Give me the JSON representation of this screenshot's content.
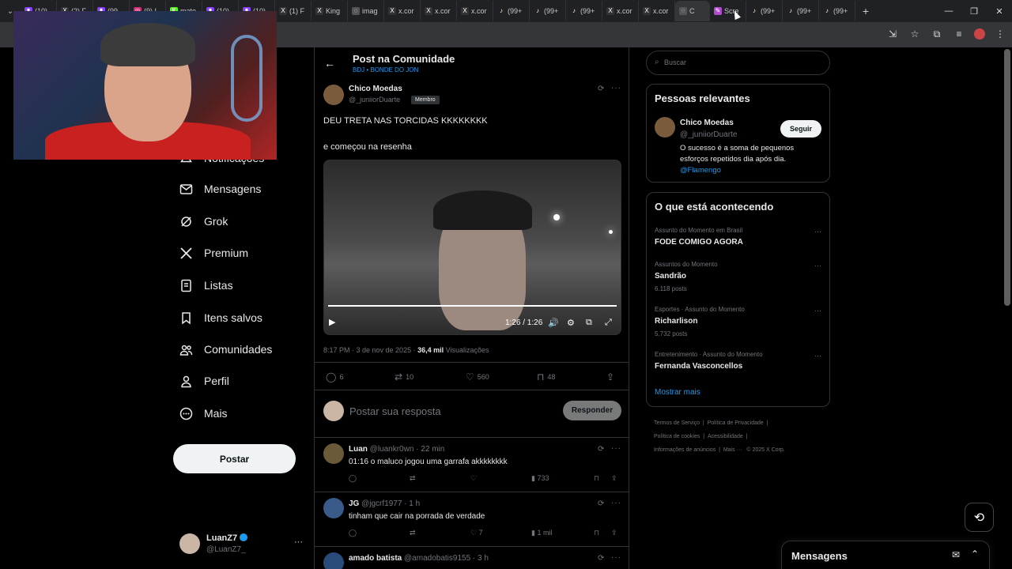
{
  "browser": {
    "tabs": [
      {
        "label": "(10)",
        "icon": "twitch-icon",
        "color": "#8a3ffc"
      },
      {
        "label": "(2) F",
        "icon": "x-icon",
        "color": "#333333"
      },
      {
        "label": "(99",
        "icon": "twitch-icon",
        "color": "#8a3ffc"
      },
      {
        "label": "(9) I",
        "icon": "instagram-icon",
        "color": "#d62976"
      },
      {
        "label": "mate",
        "icon": "kick-icon",
        "color": "#53fc18"
      },
      {
        "label": "(10)",
        "icon": "twitch-icon",
        "color": "#8a3ffc"
      },
      {
        "label": "(10)",
        "icon": "twitch-icon",
        "color": "#8a3ffc"
      },
      {
        "label": "(1) F",
        "icon": "x-icon",
        "color": "#333333"
      },
      {
        "label": "King",
        "icon": "x-icon",
        "color": "#333333"
      },
      {
        "label": "imag",
        "icon": "web-icon",
        "color": "#555555"
      },
      {
        "label": "x.cor",
        "icon": "x-icon",
        "color": "#333333"
      },
      {
        "label": "x.cor",
        "icon": "x-icon",
        "color": "#333333"
      },
      {
        "label": "x.cor",
        "icon": "x-icon",
        "color": "#333333"
      },
      {
        "label": "(99+",
        "icon": "tiktok-icon",
        "color": "#222222"
      },
      {
        "label": "(99+",
        "icon": "tiktok-icon",
        "color": "#222222"
      },
      {
        "label": "(99+",
        "icon": "tiktok-icon",
        "color": "#222222"
      },
      {
        "label": "x.cor",
        "icon": "x-icon",
        "color": "#333333"
      },
      {
        "label": "x.cor",
        "icon": "x-icon",
        "color": "#333333"
      },
      {
        "label": "C",
        "icon": "web-icon",
        "color": "#555555",
        "active": true
      },
      {
        "label": "Scre",
        "icon": "screen-icon",
        "color": "#b04ad0"
      },
      {
        "label": "(99+",
        "icon": "tiktok-icon",
        "color": "#222222"
      },
      {
        "label": "(99+",
        "icon": "tiktok-icon",
        "color": "#222222"
      },
      {
        "label": "(99+",
        "icon": "tiktok-icon",
        "color": "#222222"
      }
    ]
  },
  "nav": {
    "items": [
      {
        "label": "Notificações",
        "icon": "bell-icon"
      },
      {
        "label": "Mensagens",
        "icon": "mail-icon"
      },
      {
        "label": "Grok",
        "icon": "grok-icon"
      },
      {
        "label": "Premium",
        "icon": "x-logo-icon"
      },
      {
        "label": "Listas",
        "icon": "list-icon"
      },
      {
        "label": "Itens salvos",
        "icon": "bookmark-icon"
      },
      {
        "label": "Comunidades",
        "icon": "people-icon"
      },
      {
        "label": "Perfil",
        "icon": "person-icon"
      },
      {
        "label": "Mais",
        "icon": "more-circle-icon"
      }
    ],
    "post_button": "Postar",
    "account": {
      "name": "LuanZ7",
      "handle": "@LuanZ7_"
    }
  },
  "header": {
    "title": "Post na Comunidade",
    "subtitle": "BDJ • BONDE DO JON"
  },
  "post": {
    "author": "Chico Moedas",
    "handle": "@_juniiorDuarte",
    "badge": "Membro",
    "text_line1": "DEU TRETA NAS TORCIDAS KKKKKKKK",
    "text_line2": "e começou na resenha",
    "video_time": "1:26 / 1:26",
    "video_progress": 1.0,
    "timestamp": "8:17 PM · 3 de nov de 2025 · ",
    "views": "36,4 mil",
    "views_label": "Visualizações",
    "replies": "6",
    "reposts": "10",
    "likes": "560",
    "bookmarks": "48"
  },
  "reply_box": {
    "placeholder": "Postar sua resposta",
    "button": "Responder"
  },
  "comments": [
    {
      "name": "Luan",
      "meta": "@luankr0wn · 22 min",
      "text": "01:16 o maluco jogou uma garrafa akkkkkkkk",
      "likes": "",
      "views": "733",
      "avatar_color": "#6a5a3a"
    },
    {
      "name": "JG",
      "meta": "@jgcrf1977 · 1 h",
      "text": "tinham que cair na porrada de verdade",
      "likes": "7",
      "views": "1 mil",
      "avatar_color": "#3a5a8a"
    },
    {
      "name": "amado batista",
      "meta": "@amadobatis9155 · 3 h",
      "text": "",
      "avatar_color": "#2a4a7a"
    }
  ],
  "right": {
    "search_placeholder": "Buscar",
    "relevant": {
      "title": "Pessoas relevantes",
      "name": "Chico Moedas",
      "handle": "@_juniiorDuarte",
      "follow": "Seguir",
      "bio": "O sucesso é a soma de pequenos esforços repetidos dia após dia.",
      "bio_link": "@Flamengo"
    },
    "trends": {
      "title": "O que está acontecendo",
      "items": [
        {
          "category": "Assunto do Momento em Brasil",
          "name": "FODE COMIGO AGORA",
          "count": ""
        },
        {
          "category": "Assuntos do Momento",
          "name": "Sandrão",
          "count": "6.118 posts"
        },
        {
          "category": "Esportes · Assunto do Momento",
          "name": "Richarlison",
          "count": "5.732 posts"
        },
        {
          "category": "Entretenimento · Assunto do Momento",
          "name": "Fernanda Vasconcellos",
          "count": ""
        }
      ],
      "show_more": "Mostrar mais"
    },
    "footer": {
      "l1a": "Termos de Serviço",
      "l1b": "Política de Privacidade",
      "l2a": "Política de cookies",
      "l2b": "Acessibilidade",
      "l3a": "Informações de anúncios",
      "l3b": "Mais ···",
      "l3c": "© 2025 X Corp."
    }
  },
  "messages_drawer": {
    "title": "Mensagens"
  },
  "colors": {
    "accent": "#1d9bf0",
    "bg": "#000000",
    "border": "#2f3336",
    "muted": "#71767b"
  }
}
